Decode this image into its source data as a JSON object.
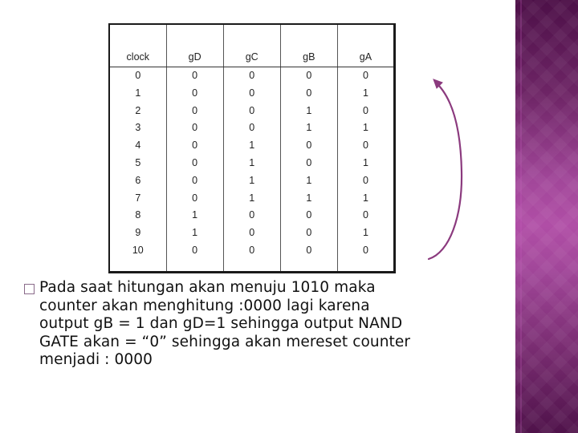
{
  "slide": {
    "accent_color": "#8b3a7e",
    "sidebar_color": "#a2479a"
  },
  "table": {
    "headers": [
      "clock",
      "gD",
      "gC",
      "gB",
      "gA"
    ],
    "rows": [
      [
        "0",
        "0",
        "0",
        "0",
        "0"
      ],
      [
        "1",
        "0",
        "0",
        "0",
        "1"
      ],
      [
        "2",
        "0",
        "0",
        "1",
        "0"
      ],
      [
        "3",
        "0",
        "0",
        "1",
        "1"
      ],
      [
        "4",
        "0",
        "1",
        "0",
        "0"
      ],
      [
        "5",
        "0",
        "1",
        "0",
        "1"
      ],
      [
        "6",
        "0",
        "1",
        "1",
        "0"
      ],
      [
        "7",
        "0",
        "1",
        "1",
        "1"
      ],
      [
        "8",
        "1",
        "0",
        "0",
        "0"
      ],
      [
        "9",
        "1",
        "0",
        "0",
        "1"
      ],
      [
        "10",
        "0",
        "0",
        "0",
        "0"
      ]
    ]
  },
  "annotation": {
    "arrow_icon": "curved-arrow-up",
    "arrow_color": "#8b3a7e"
  },
  "bullets": [
    {
      "icon": "hollow-square-bullet",
      "text": "Pada saat hitungan akan menuju 1010 maka\ncounter akan menghitung :0000 lagi karena\noutput gB = 1 dan gD=1 sehingga output NAND\nGATE akan = “0” sehingga akan mereset counter\nmenjadi : 0000"
    }
  ]
}
